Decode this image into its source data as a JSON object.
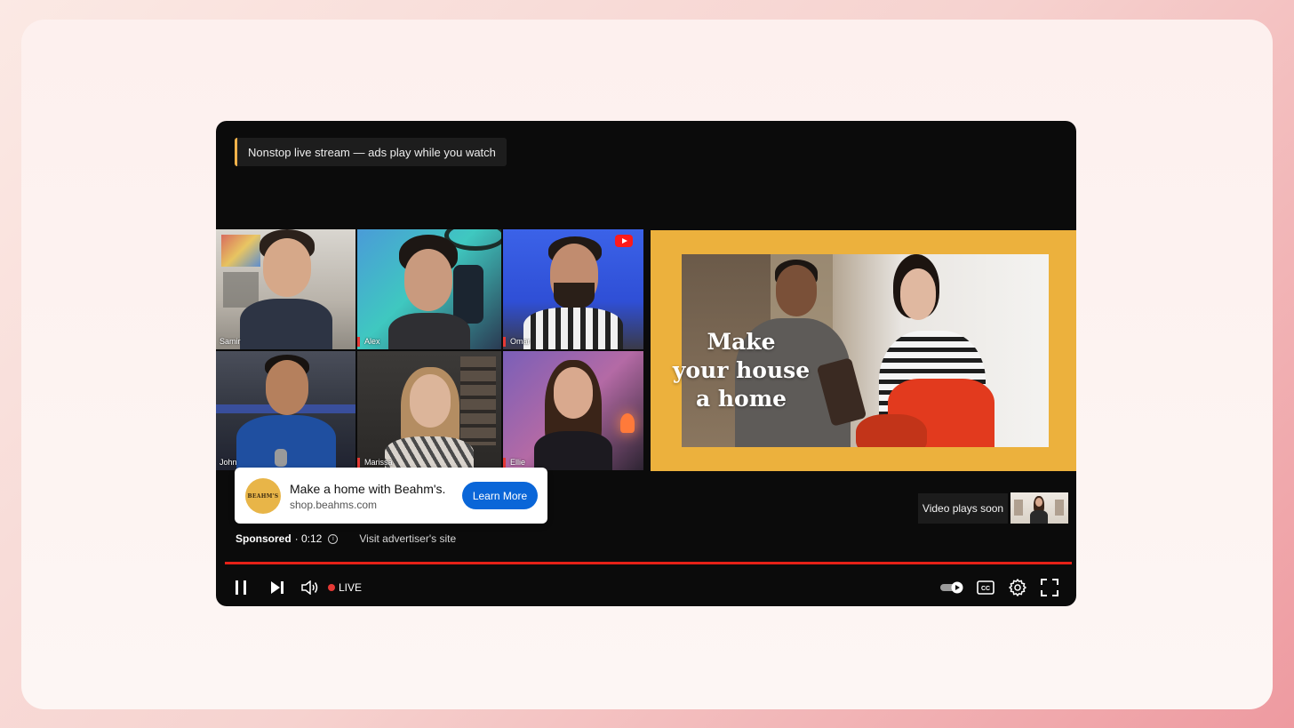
{
  "banner": {
    "text": "Nonstop live stream — ads play while you watch"
  },
  "participants": [
    {
      "name": "Samir",
      "mic_active": false
    },
    {
      "name": "Alex",
      "mic_active": true
    },
    {
      "name": "Omar",
      "mic_active": true
    },
    {
      "name": "John",
      "mic_active": false
    },
    {
      "name": "Marissa",
      "mic_active": true
    },
    {
      "name": "Ellie",
      "mic_active": true
    }
  ],
  "ad_creative": {
    "headline_lines": [
      "Make",
      "your house",
      "a home"
    ]
  },
  "ad_card": {
    "logo_text": "BEAHM'S",
    "title": "Make a home with Beahm's.",
    "url": "shop.beahms.com",
    "button": "Learn More"
  },
  "ad_info": {
    "sponsored": "Sponsored",
    "time": "· 0:12",
    "visit": "Visit advertiser's site"
  },
  "next_video": {
    "label": "Video plays soon"
  },
  "controls": {
    "live_label": "LIVE",
    "progress": 1.0
  },
  "colors": {
    "accent_red": "#e62117",
    "ad_frame": "#ecb13d",
    "button_blue": "#0a66d8",
    "banner_bar": "#f1b24a"
  },
  "icons": [
    "pause-icon",
    "next-icon",
    "volume-icon",
    "autoplay-toggle-icon",
    "captions-icon",
    "settings-gear-icon",
    "fullscreen-icon",
    "youtube-icon",
    "info-icon"
  ]
}
